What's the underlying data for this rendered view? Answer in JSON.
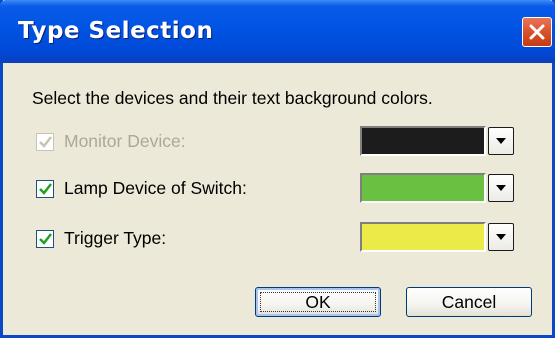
{
  "dialog": {
    "title": "Type Selection",
    "close_icon": "close-icon",
    "prompt": "Select the devices and their text background colors."
  },
  "devices": [
    {
      "label": "Monitor Device:",
      "checked": true,
      "enabled": false,
      "color": "#1c1c1c"
    },
    {
      "label": "Lamp Device of Switch:",
      "checked": true,
      "enabled": true,
      "color": "#6ac040"
    },
    {
      "label": "Trigger Type:",
      "checked": true,
      "enabled": true,
      "color": "#ecea48"
    }
  ],
  "buttons": {
    "ok": "OK",
    "cancel": "Cancel"
  },
  "colors": {
    "titlebar": "#0054e3",
    "close_button": "#d9512a",
    "dialog_bg": "#ece9d8",
    "checkbox_border": "#1c5180",
    "check_mark": "#21a121"
  }
}
